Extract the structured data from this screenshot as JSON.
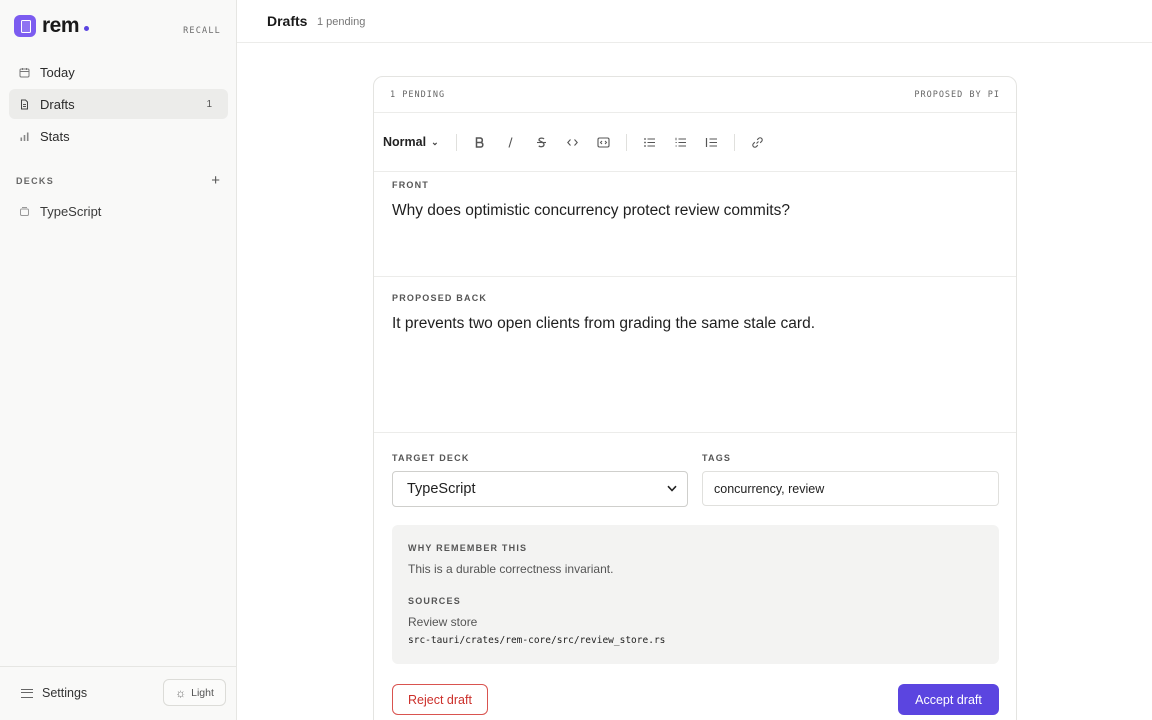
{
  "brand": {
    "name": "rem",
    "tag": "RECALL",
    "accent": "#5b45e0"
  },
  "nav": {
    "items": [
      {
        "label": "Today",
        "icon": "calendar-icon"
      },
      {
        "label": "Drafts",
        "icon": "document-icon",
        "count": "1"
      },
      {
        "label": "Stats",
        "icon": "bar-chart-icon"
      }
    ]
  },
  "decks": {
    "label": "DECKS",
    "add": "+",
    "items": [
      {
        "label": "TypeScript",
        "icon": "deck-icon"
      }
    ]
  },
  "footer": {
    "settings_label": "Settings",
    "theme_label": "Light"
  },
  "header": {
    "title": "Drafts",
    "subtitle": "1 pending"
  },
  "card": {
    "status": "1 PENDING",
    "proposed_by": "PROPOSED BY PI",
    "toolbar": {
      "style_value": "Normal"
    },
    "front_label": "FRONT",
    "front_text": "Why does optimistic concurrency protect review commits?",
    "back_label": "PROPOSED BACK",
    "back_text": "It prevents two open clients from grading the same stale card.",
    "target_deck_label": "TARGET DECK",
    "target_deck_value": "TypeScript",
    "tags_label": "TAGS",
    "tags_value": "concurrency, review",
    "why_label": "WHY REMEMBER THIS",
    "why_text": "This is a durable correctness invariant.",
    "sources_label": "SOURCES",
    "source_name": "Review store",
    "source_path": "src-tauri/crates/rem-core/src/review_store.rs",
    "reject_label": "Reject draft",
    "accept_label": "Accept draft"
  }
}
